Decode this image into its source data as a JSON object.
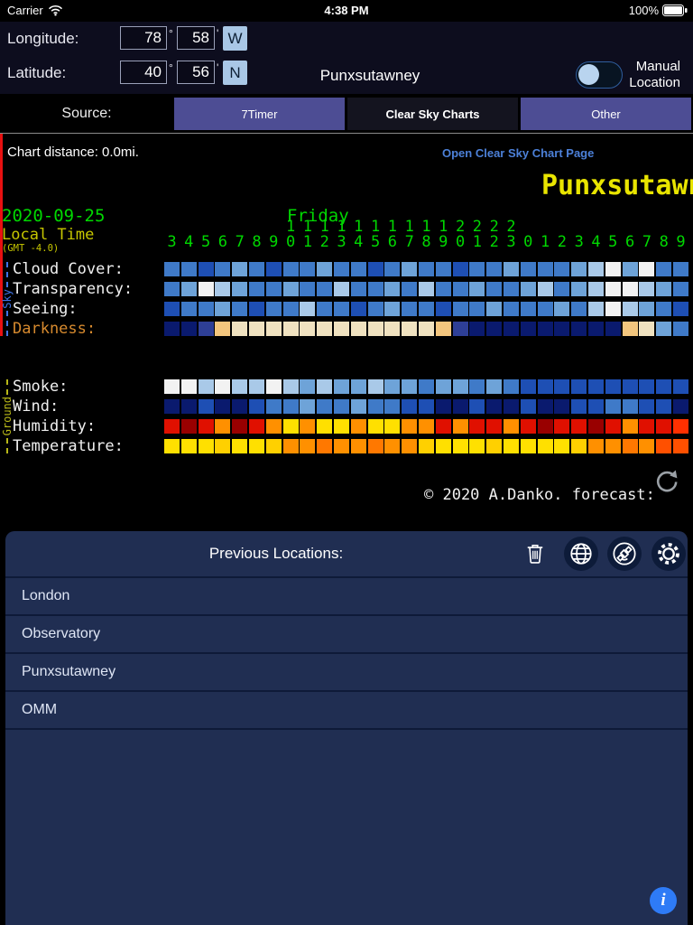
{
  "status_bar": {
    "carrier": "Carrier",
    "time": "4:38 PM",
    "battery_percent": "100%"
  },
  "header": {
    "longitude_label": "Longitude:",
    "latitude_label": "Latitude:",
    "longitude": {
      "degrees": "78",
      "minutes": "58",
      "direction": "W"
    },
    "latitude": {
      "degrees": "40",
      "minutes": "56",
      "direction": "N"
    },
    "degree_symbol": "°",
    "minute_symbol": "'",
    "location_title": "Punxsutawney",
    "manual_location_label": "Manual Location",
    "manual_location_enabled": false
  },
  "source": {
    "label": "Source:",
    "options": [
      "7Timer",
      "Clear Sky Charts",
      "Other"
    ],
    "selected": "Clear Sky Charts"
  },
  "chart_header": {
    "distance_text": "Chart distance: 0.0mi.",
    "open_link_text": "Open Clear Sky Chart Page"
  },
  "chart_data": {
    "type": "heatmap",
    "title": "Punxsutawney",
    "date": "2020-09-25",
    "weekday": "Friday",
    "time_axis_label": "Local Time",
    "timezone": "(GMT -4.0)",
    "hours": [
      3,
      4,
      5,
      6,
      7,
      8,
      9,
      10,
      11,
      12,
      13,
      14,
      15,
      16,
      17,
      18,
      19,
      20,
      21,
      22,
      23,
      0,
      1,
      2,
      3,
      4,
      5,
      6,
      7,
      8,
      9
    ],
    "current_time_hour": 0,
    "current_time_index": 21,
    "sky_axis": "Sky",
    "ground_axis": "Ground",
    "sky_rows": [
      {
        "label": "Cloud Cover:",
        "label_color": "#f0f0f0",
        "colors": [
          "#3f7ac8",
          "#3f7ac8",
          "#1e4fb4",
          "#3f7ac8",
          "#6ea3d8",
          "#3f7ac8",
          "#1e4fb4",
          "#3f7ac8",
          "#3f7ac8",
          "#6ea3d8",
          "#3f7ac8",
          "#3f7ac8",
          "#1e4fb4",
          "#3f7ac8",
          "#6ea3d8",
          "#3f7ac8",
          "#3f7ac8",
          "#1e4fb4",
          "#3f7ac8",
          "#3f7ac8",
          "#6ea3d8",
          "#3f7ac8",
          "#3f7ac8",
          "#3f7ac8",
          "#6ea3d8",
          "#a9c9e8",
          "#f2f2f2",
          "#6ea3d8",
          "#f2f2f2",
          "#3f7ac8",
          "#3f7ac8"
        ]
      },
      {
        "label": "Transparency:",
        "label_color": "#f0f0f0",
        "colors": [
          "#3f7ac8",
          "#6ea3d8",
          "#f2f2f2",
          "#a9c9e8",
          "#6ea3d8",
          "#3f7ac8",
          "#3f7ac8",
          "#6ea3d8",
          "#3f7ac8",
          "#3f7ac8",
          "#a9c9e8",
          "#3f7ac8",
          "#3f7ac8",
          "#6ea3d8",
          "#3f7ac8",
          "#a9c9e8",
          "#3f7ac8",
          "#3f7ac8",
          "#6ea3d8",
          "#3f7ac8",
          "#3f7ac8",
          "#6ea3d8",
          "#a9c9e8",
          "#3f7ac8",
          "#6ea3d8",
          "#a9c9e8",
          "#f2f2f2",
          "#f2f2f2",
          "#a9c9e8",
          "#6ea3d8",
          "#3f7ac8"
        ]
      },
      {
        "label": "Seeing:",
        "label_color": "#f0f0f0",
        "colors": [
          "#1e4fb4",
          "#3f7ac8",
          "#3f7ac8",
          "#6ea3d8",
          "#3f7ac8",
          "#1e4fb4",
          "#3f7ac8",
          "#3f7ac8",
          "#a9c9e8",
          "#3f7ac8",
          "#3f7ac8",
          "#1e4fb4",
          "#3f7ac8",
          "#6ea3d8",
          "#3f7ac8",
          "#3f7ac8",
          "#1e4fb4",
          "#3f7ac8",
          "#3f7ac8",
          "#6ea3d8",
          "#3f7ac8",
          "#3f7ac8",
          "#3f7ac8",
          "#6ea3d8",
          "#3f7ac8",
          "#a9c9e8",
          "#f2f2f2",
          "#a9c9e8",
          "#6ea3d8",
          "#3f7ac8",
          "#1e4fb4"
        ]
      },
      {
        "label": "Darkness:",
        "label_color": "#d78a2e",
        "colors": [
          "#0a1a6e",
          "#0a1a6e",
          "#2e3f96",
          "#f3c67e",
          "#f0e2c0",
          "#f0e2c0",
          "#f0e2c0",
          "#f0e2c0",
          "#f0e2c0",
          "#f0e2c0",
          "#f0e2c0",
          "#f0e2c0",
          "#f0e2c0",
          "#f0e2c0",
          "#f0e2c0",
          "#f0e2c0",
          "#f3c67e",
          "#2e3f96",
          "#0a1a6e",
          "#0a1a6e",
          "#0a1a6e",
          "#0a1a6e",
          "#0a1a6e",
          "#0a1a6e",
          "#0a1a6e",
          "#0a1a6e",
          "#0a1a6e",
          "#f3c67e",
          "#f0e2c0",
          "#6ea3d8",
          "#3f7ac8"
        ]
      }
    ],
    "ground_rows": [
      {
        "label": "Smoke:",
        "label_color": "#f0f0f0",
        "colors": [
          "#f2f2f2",
          "#f2f2f2",
          "#a9c9e8",
          "#f2f2f2",
          "#a9c9e8",
          "#a9c9e8",
          "#f2f2f2",
          "#a9c9e8",
          "#6ea3d8",
          "#a9c9e8",
          "#6ea3d8",
          "#6ea3d8",
          "#a9c9e8",
          "#6ea3d8",
          "#6ea3d8",
          "#3f7ac8",
          "#6ea3d8",
          "#6ea3d8",
          "#3f7ac8",
          "#6ea3d8",
          "#3f7ac8",
          "#1e4fb4",
          "#1e4fb4",
          "#1e4fb4",
          "#1e4fb4",
          "#1e4fb4",
          "#1e4fb4",
          "#1e4fb4",
          "#1e4fb4",
          "#1e4fb4",
          "#1e4fb4"
        ]
      },
      {
        "label": "Wind:",
        "label_color": "#f0f0f0",
        "colors": [
          "#0a1a6e",
          "#0a1a6e",
          "#1e4fb4",
          "#0a1a6e",
          "#0a1a6e",
          "#1e4fb4",
          "#3f7ac8",
          "#3f7ac8",
          "#6ea3d8",
          "#3f7ac8",
          "#3f7ac8",
          "#6ea3d8",
          "#3f7ac8",
          "#3f7ac8",
          "#1e4fb4",
          "#1e4fb4",
          "#0a1a6e",
          "#0a1a6e",
          "#1e4fb4",
          "#0a1a6e",
          "#0a1a6e",
          "#1e4fb4",
          "#0a1a6e",
          "#0a1a6e",
          "#1e4fb4",
          "#1e4fb4",
          "#3f7ac8",
          "#3f7ac8",
          "#1e4fb4",
          "#1e4fb4",
          "#0a1a6e"
        ]
      },
      {
        "label": "Humidity:",
        "label_color": "#f0f0f0",
        "colors": [
          "#e01000",
          "#990000",
          "#e01000",
          "#ff9000",
          "#990000",
          "#e01000",
          "#ff9000",
          "#ffe000",
          "#ff9000",
          "#ffe000",
          "#ffe000",
          "#ff9000",
          "#ffe000",
          "#ffe000",
          "#ff9000",
          "#ff9000",
          "#e01000",
          "#ff9000",
          "#e01000",
          "#e01000",
          "#ff9000",
          "#e01000",
          "#990000",
          "#e01000",
          "#e01000",
          "#990000",
          "#e01000",
          "#ff9000",
          "#e01000",
          "#e01000",
          "#ff3000"
        ]
      },
      {
        "label": "Temperature:",
        "label_color": "#f0f0f0",
        "colors": [
          "#ffe000",
          "#ffe000",
          "#ffe000",
          "#ffd000",
          "#ffe000",
          "#ffe000",
          "#ffd000",
          "#ff9000",
          "#ff9000",
          "#ff7800",
          "#ff9000",
          "#ff9000",
          "#ff7800",
          "#ff9000",
          "#ff9000",
          "#ffd000",
          "#ffe000",
          "#ffe000",
          "#ffe000",
          "#ffd000",
          "#ffe000",
          "#ffe000",
          "#ffe000",
          "#ffe000",
          "#ffd000",
          "#ff9000",
          "#ff9000",
          "#ff7800",
          "#ff9000",
          "#ff5000",
          "#ff5000"
        ]
      }
    ],
    "copyright": "© 2020 A.Danko.  forecast:"
  },
  "panel": {
    "title": "Previous Locations:",
    "locations": [
      "London",
      "Observatory",
      "Punxsutawney",
      "OMM"
    ]
  },
  "colors": {
    "accent_link": "#4c80d8",
    "chart_title_yellow": "#e9e500",
    "chart_green": "#00d800",
    "chart_olive": "#c6c600",
    "darkness_label_orange": "#d78a2e",
    "current_time_line_red": "#e81010",
    "sky_axis_blue": "#3f73e8",
    "ground_axis_olive": "#b8b818",
    "source_button": "#4d4d94",
    "source_button_selected": "#14141f",
    "direction_button": "#a9c7e6",
    "panel_background": "#202e52",
    "info_button_blue": "#2e7bf6"
  }
}
